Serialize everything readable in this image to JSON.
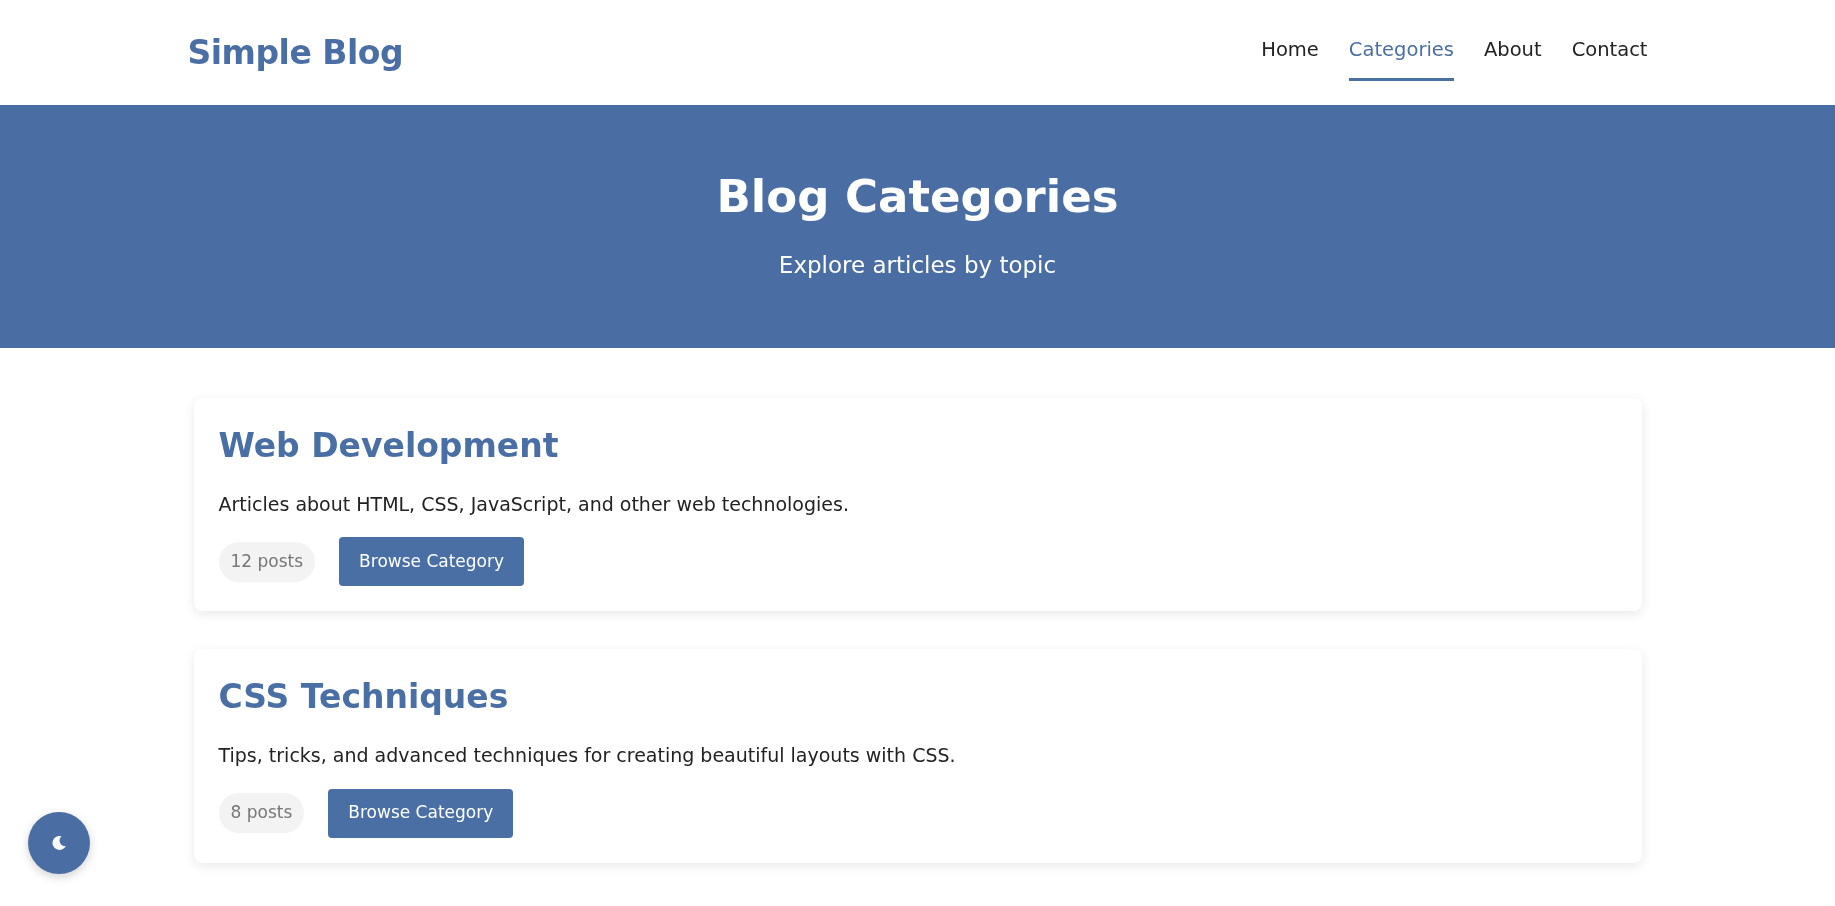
{
  "navbar": {
    "brand": "Simple Blog",
    "links": [
      {
        "label": "Home",
        "selected": false
      },
      {
        "label": "Categories",
        "selected": true
      },
      {
        "label": "About",
        "selected": false
      },
      {
        "label": "Contact",
        "selected": false
      }
    ]
  },
  "hero": {
    "title": "Blog Categories",
    "subtitle": "Explore articles by topic"
  },
  "categories": [
    {
      "title": "Web Development",
      "description": "Articles about HTML, CSS, JavaScript, and other web technologies.",
      "count": "12 posts",
      "button": "Browse Category"
    },
    {
      "title": "CSS Techniques",
      "description": "Tips, tricks, and advanced techniques for creating beautiful layouts with CSS.",
      "count": "8 posts",
      "button": "Browse Category"
    }
  ]
}
